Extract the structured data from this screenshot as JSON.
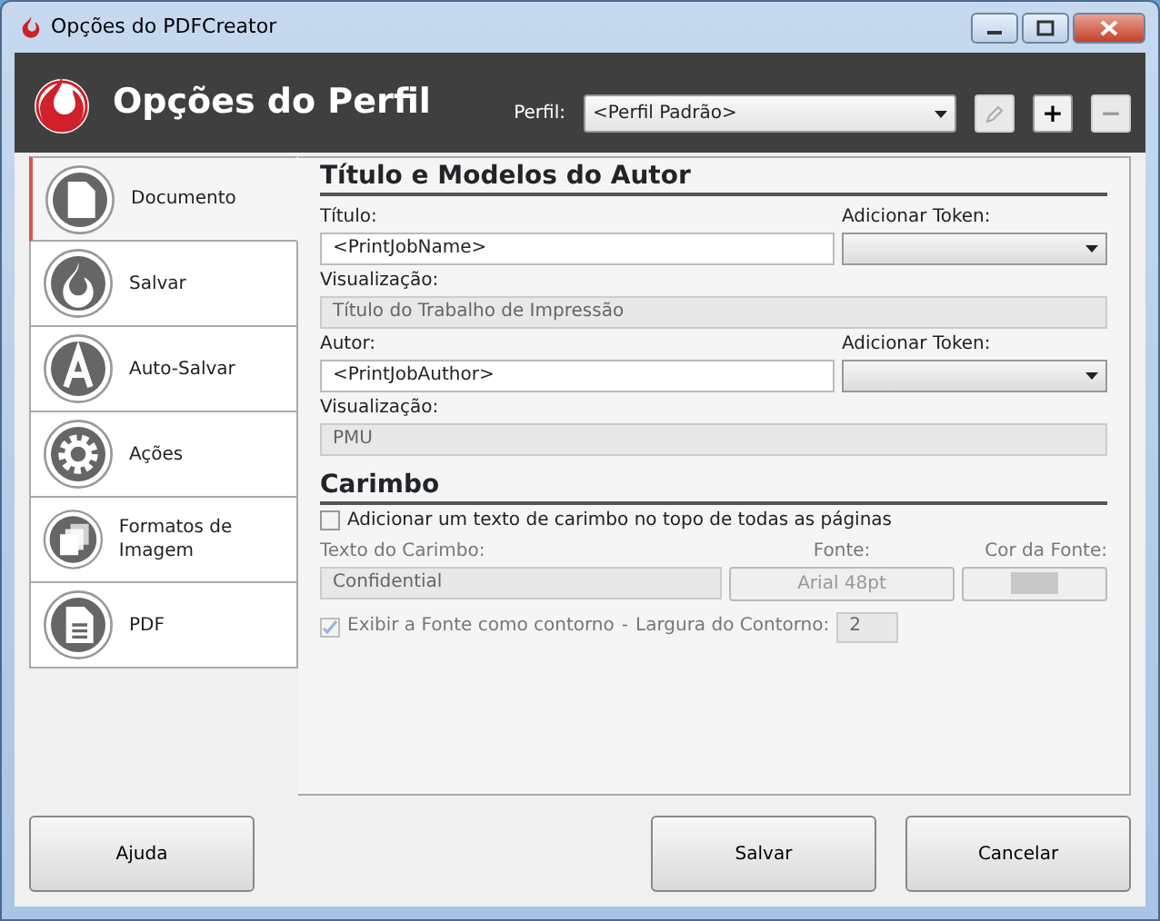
{
  "window": {
    "title": "Opções do PDFCreator"
  },
  "header": {
    "title": "Opções do Perfil",
    "profile_label": "Perfil:",
    "profile_value": "<Perfil Padrão>",
    "profile_buttons": [
      {
        "kind": "edit",
        "disabled": true
      },
      {
        "kind": "add",
        "label": "+",
        "disabled": false
      },
      {
        "kind": "remove",
        "label": "−",
        "disabled": true
      }
    ]
  },
  "sidebar": {
    "items": [
      {
        "label": "Documento",
        "kind": "document",
        "selected": true
      },
      {
        "label": "Salvar",
        "kind": "flame",
        "selected": false
      },
      {
        "label": "Auto-Salvar",
        "kind": "letter",
        "selected": false
      },
      {
        "label": "Ações",
        "kind": "gear",
        "selected": false
      },
      {
        "label": "Formatos de Imagem",
        "kind": "pages",
        "selected": false
      },
      {
        "label": "PDF",
        "kind": "pdf",
        "selected": false
      }
    ]
  },
  "author_section": {
    "title": "Título e Modelos do Autor",
    "rows": [
      {
        "label": "Título:",
        "value": "<PrintJobName>",
        "token_label": "Adicionar Token:",
        "preview_label": "Visualização:",
        "preview": "Título do Trabalho de Impressão"
      },
      {
        "label": "Autor:",
        "value": "<PrintJobAuthor>",
        "token_label": "Adicionar Token:",
        "preview_label": "Visualização:",
        "preview": "PMU"
      }
    ]
  },
  "stamp_section": {
    "title": "Carimbo",
    "enable": {
      "label": "Adicionar um texto de carimbo no topo de todas as páginas",
      "checked": false
    },
    "text_label": "Texto do Carimbo:",
    "text_value": "Confidential",
    "disabled": true,
    "font_label": "Fonte:",
    "font_value": "Arial 48pt",
    "color_label": "Cor da Fonte:",
    "outline": {
      "label": "Exibir a Fonte como contorno",
      "checked": true
    },
    "separator": "-",
    "width_label": "Largura do Contorno:",
    "width_value": "2"
  },
  "buttons": [
    {
      "label": "Ajuda",
      "kind": "left"
    },
    {
      "label": "Salvar",
      "kind": "right"
    },
    {
      "label": "Cancelar",
      "kind": "right"
    }
  ]
}
